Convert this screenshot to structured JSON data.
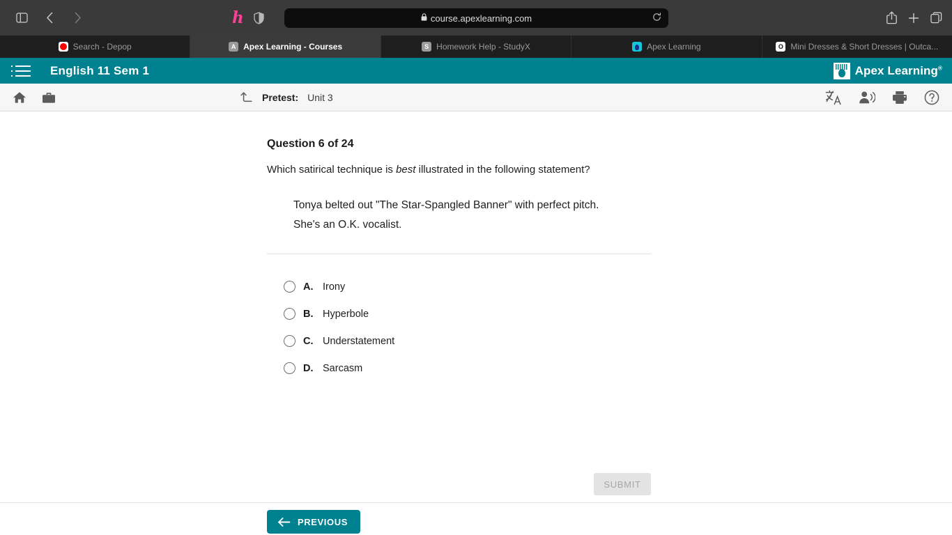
{
  "browser": {
    "sidebar_toggle": "sidebar-toggle",
    "back": "back",
    "forward": "forward",
    "url": "course.apexlearning.com",
    "lock": "⌂",
    "reload": "↻",
    "share": "share",
    "new_tab": "+",
    "tab_overview": "tabs",
    "honey_label": "h",
    "tabs": [
      {
        "label": "Search - Depop",
        "favicon": "depop-favicon",
        "favicon_text": "",
        "active": false
      },
      {
        "label": "Apex Learning - Courses",
        "favicon": "apex-favicon",
        "favicon_text": "A",
        "active": true
      },
      {
        "label": "Homework Help - StudyX",
        "favicon": "studyx-favicon",
        "favicon_text": "S",
        "active": false
      },
      {
        "label": "Apex Learning",
        "favicon": "apexlogo-favicon",
        "favicon_text": "",
        "active": false
      },
      {
        "label": "Mini Dresses & Short Dresses | Outca...",
        "favicon": "outca-favicon",
        "favicon_text": "O",
        "active": false
      }
    ]
  },
  "app_header": {
    "menu_icon": "hamburger-menu-icon",
    "course_title": "English 11 Sem 1",
    "brand_name": "Apex Learning",
    "brand_tm": "®",
    "accent_color": "#00818f"
  },
  "sub_toolbar": {
    "home_icon": "home-icon",
    "briefcase_icon": "briefcase-icon",
    "up_level_icon": "up-level-arrow-icon",
    "breadcrumb_label": "Pretest:",
    "breadcrumb_value": "Unit 3",
    "translate_icon": "translate-icon",
    "read-aloud_icon": "read-aloud-icon",
    "print_icon": "print-icon",
    "help_icon": "help-icon"
  },
  "question": {
    "number_label": "Question 6 of 24",
    "stem_before": "Which satirical technique is ",
    "stem_emphasis": "best",
    "stem_after": " illustrated in the following statement?",
    "quote": "Tonya belted out \"The Star-Spangled Banner\" with perfect pitch. She's an O.K. vocalist.",
    "options": [
      {
        "letter": "A.",
        "text": "Irony",
        "selected": false
      },
      {
        "letter": "B.",
        "text": "Hyperbole",
        "selected": false
      },
      {
        "letter": "C.",
        "text": "Understatement",
        "selected": false
      },
      {
        "letter": "D.",
        "text": "Sarcasm",
        "selected": false
      }
    ],
    "submit_label": "SUBMIT",
    "submit_enabled": false
  },
  "footer": {
    "previous_label": "PREVIOUS",
    "previous_arrow": "arrow-left-icon"
  }
}
